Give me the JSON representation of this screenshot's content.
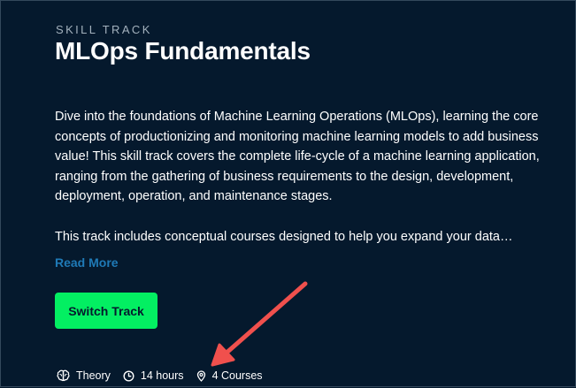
{
  "track": {
    "eyebrow": "SKILL TRACK",
    "title": "MLOps Fundamentals",
    "description_p1": "Dive into the foundations of Machine Learning Operations (MLOps), learning the core concepts of productionizing and monitoring machine learning models to add business value! This skill track covers the complete life-cycle of a machine learning application, ranging from the gathering of business requirements to the design, development, deployment, operation, and maintenance stages.",
    "description_p2": "This track includes conceptual courses designed to help you expand your data…",
    "read_more_label": "Read More",
    "switch_button_label": "Switch Track"
  },
  "meta": {
    "type_label": "Theory",
    "duration_label": "14 hours",
    "courses_label": "4 Courses",
    "type_icon": "brain-icon",
    "duration_icon": "clock-icon",
    "courses_icon": "location-pin-icon"
  },
  "annotation": {
    "arrow_color": "#f0504d"
  },
  "colors": {
    "background": "#05192d",
    "accent_green": "#03ef62",
    "link_blue": "#1f7ab7"
  }
}
